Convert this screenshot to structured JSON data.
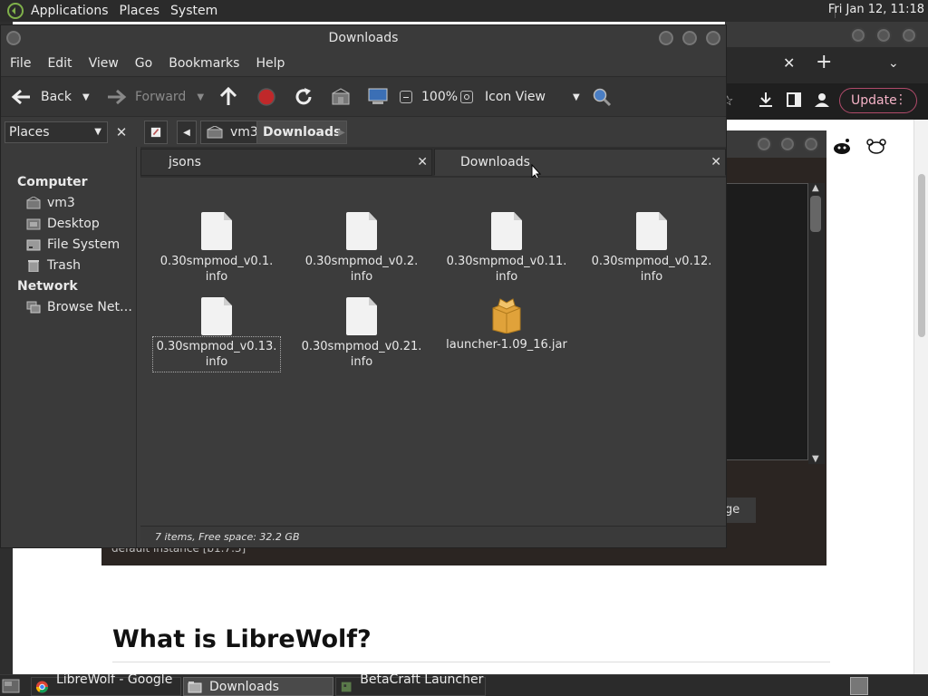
{
  "top_panel": {
    "menus": [
      "Applications",
      "Places",
      "System"
    ],
    "clock": "Fri Jan 12, 11:18"
  },
  "browser": {
    "update_label": "Update",
    "heading": "What is LibreWolf?",
    "instance_text": "default instance [b1.7.3]",
    "manage_text": "ge"
  },
  "file_manager": {
    "title": "Downloads",
    "menus": [
      "File",
      "Edit",
      "View",
      "Go",
      "Bookmarks",
      "Help"
    ],
    "toolbar": {
      "back": "Back",
      "forward": "Forward",
      "zoom": "100%",
      "view_mode": "Icon View"
    },
    "places_combo": "Places",
    "breadcrumb": [
      "vm3",
      "Downloads"
    ],
    "sidebar": {
      "computer_header": "Computer",
      "computer_items": [
        "vm3",
        "Desktop",
        "File System",
        "Trash"
      ],
      "network_header": "Network",
      "network_items": [
        "Browse Net…"
      ]
    },
    "tabs": [
      "jsons",
      "Downloads"
    ],
    "files": [
      {
        "line1": "0.30smpmod_v0.1.",
        "line2": "info",
        "icon": "text-file-icon"
      },
      {
        "line1": "0.30smpmod_v0.2.",
        "line2": "info",
        "icon": "text-file-icon"
      },
      {
        "line1": "0.30smpmod_v0.11.",
        "line2": "info",
        "icon": "text-file-icon"
      },
      {
        "line1": "0.30smpmod_v0.12.",
        "line2": "info",
        "icon": "text-file-icon"
      },
      {
        "line1": "0.30smpmod_v0.13.",
        "line2": "info",
        "icon": "text-file-icon"
      },
      {
        "line1": "0.30smpmod_v0.21.",
        "line2": "info",
        "icon": "text-file-icon"
      },
      {
        "line1": "launcher-1.09_16.jar",
        "line2": "",
        "icon": "package-icon"
      }
    ],
    "status": "7 items, Free space: 32.2 GB"
  },
  "taskbar": {
    "tasks": [
      "LibreWolf - Google …",
      "Downloads",
      "BetaCraft Launcher …"
    ]
  }
}
